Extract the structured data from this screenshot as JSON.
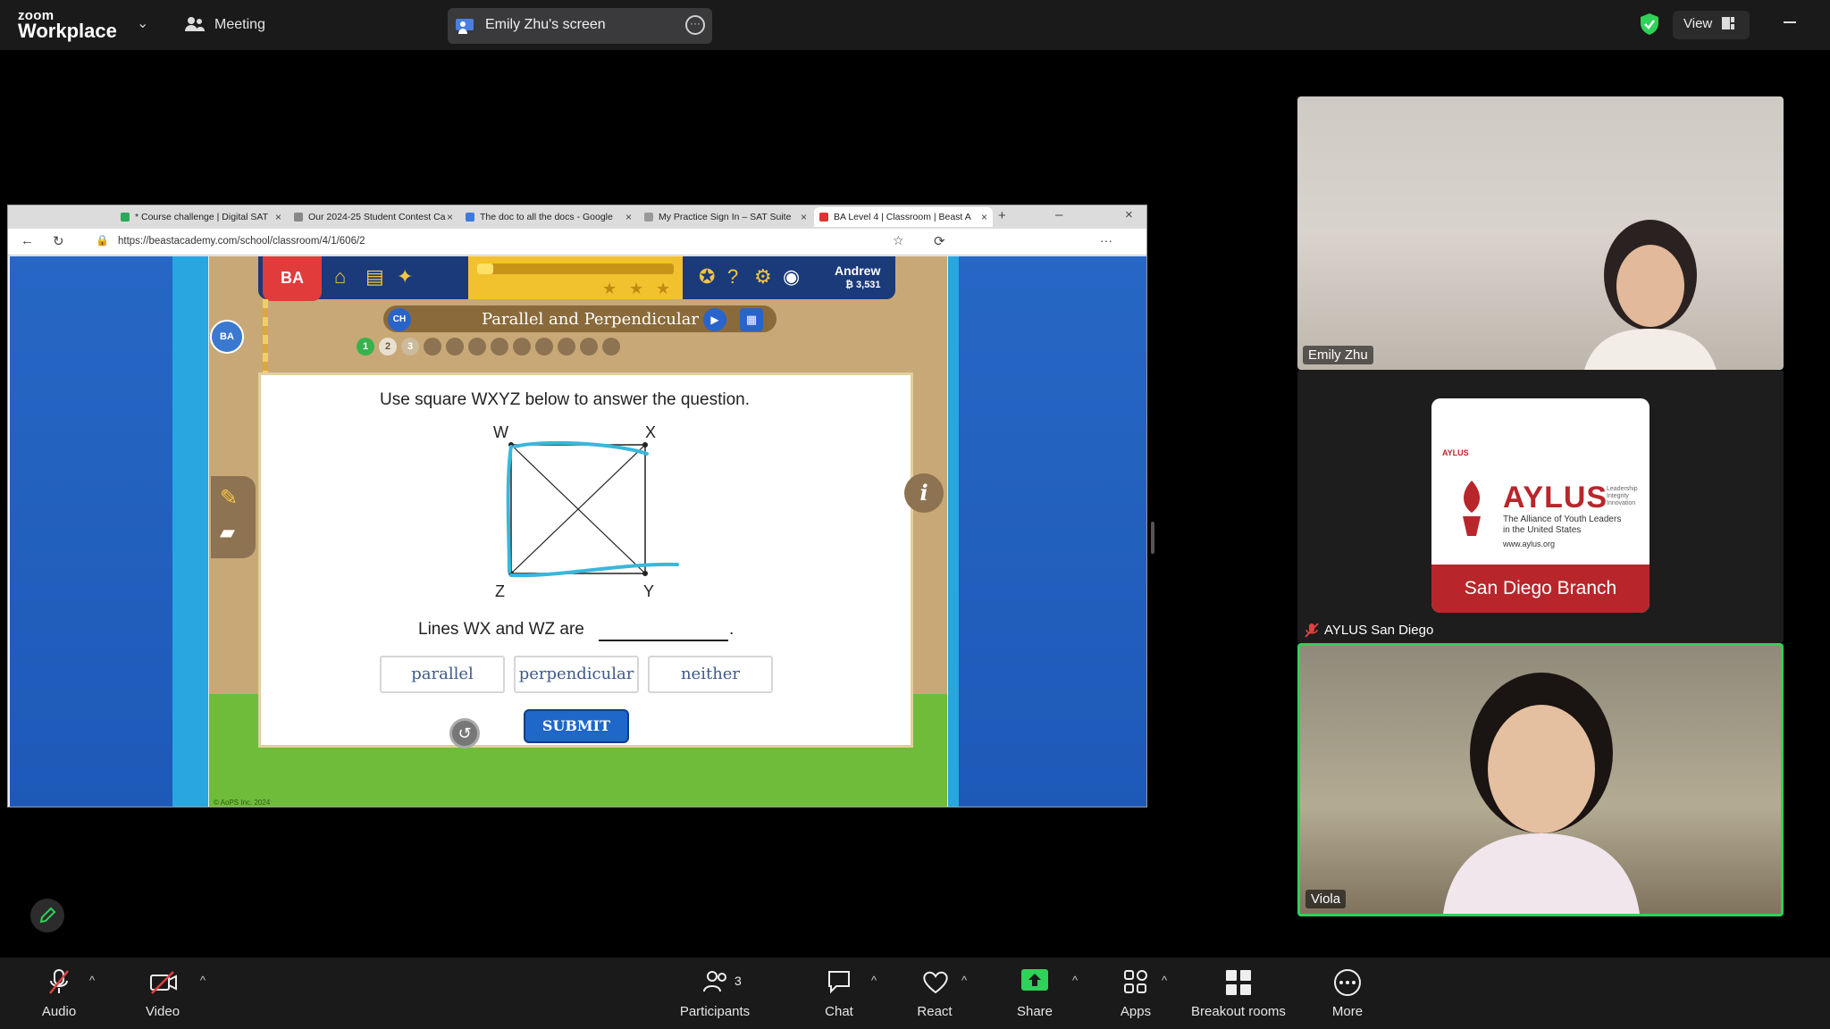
{
  "topbar": {
    "brand_top": "zoom",
    "brand_bottom": "Workplace",
    "meeting_label": "Meeting",
    "screen_share_label": "Emily Zhu's screen",
    "view_label": "View"
  },
  "browser": {
    "tabs": [
      {
        "label": "* Course challenge | Digital SAT"
      },
      {
        "label": "Our 2024-25 Student Contest Ca"
      },
      {
        "label": "The doc to all the docs - Google"
      },
      {
        "label": "My Practice Sign In – SAT Suite"
      },
      {
        "label": "BA Level 4 | Classroom | Beast A"
      }
    ],
    "url": "https://beastacademy.com/school/classroom/4/1/606/2"
  },
  "game": {
    "badge": "BA",
    "side_badge": "BA",
    "user_name": "Andrew",
    "user_points": "₿ 3,531",
    "progress_fraction": 0.08,
    "chapter_badge": "CH",
    "chapter_title": "Parallel and Perpendicular",
    "question_numbers": [
      "1",
      "2",
      "3"
    ],
    "question": "Use square WXYZ below to answer the question.",
    "vertices": {
      "w": "W",
      "x": "X",
      "y": "Y",
      "z": "Z"
    },
    "answer_prompt": "Lines WX and WZ are",
    "answer_end": ".",
    "choices": [
      "parallel",
      "perpendicular",
      "neither"
    ],
    "submit_label": "SUBMIT",
    "info_label": "i",
    "copyright": "© AoPS Inc. 2024"
  },
  "participants": {
    "emily_name": "Emily Zhu",
    "aylus_card_small": "AYLUS",
    "aylus_word": "AYLUS",
    "aylus_tagline": "The Alliance of Youth Leaders in the United States",
    "aylus_url": "www.aylus.org",
    "aylus_values": "Leadership Integrity Innovation",
    "aylus_branch": "San Diego Branch",
    "aylus_name": "AYLUS San Diego",
    "viola_name": "Viola"
  },
  "toolbar": {
    "audio": "Audio",
    "video": "Video",
    "participants": "Participants",
    "participants_count": "3",
    "chat": "Chat",
    "react": "React",
    "share": "Share",
    "apps": "Apps",
    "breakout": "Breakout rooms",
    "more": "More"
  },
  "colors": {
    "share_green": "#2fd158",
    "active_speaker": "#2fd158",
    "game_blue": "#1f67c9",
    "aylus_red": "#b8262b"
  }
}
